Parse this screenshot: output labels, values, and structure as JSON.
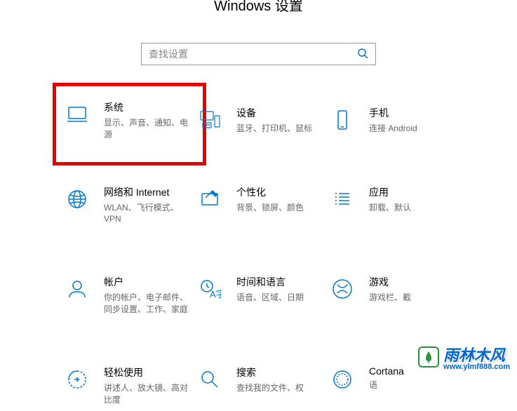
{
  "header": {
    "title": "Windows 设置"
  },
  "search": {
    "placeholder": "查找设置"
  },
  "tiles": {
    "system": {
      "title": "系统",
      "desc": "显示、声音、通知、电源"
    },
    "devices": {
      "title": "设备",
      "desc": "蓝牙、打印机、鼠标"
    },
    "phone": {
      "title": "手机",
      "desc": "连接 Android"
    },
    "network": {
      "title": "网络和 Internet",
      "desc": "WLAN、飞行模式、VPN"
    },
    "personalization": {
      "title": "个性化",
      "desc": "背景、锁屏、颜色"
    },
    "apps": {
      "title": "应用",
      "desc": "卸载、默认"
    },
    "accounts": {
      "title": "帐户",
      "desc": "你的帐户、电子邮件、同步设置、工作、家庭"
    },
    "time": {
      "title": "时间和语言",
      "desc": "语音、区域、日期"
    },
    "gaming": {
      "title": "游戏",
      "desc": "游戏栏、截"
    },
    "ease": {
      "title": "轻松使用",
      "desc": "讲述人、放大镜、高对比度"
    },
    "searchtile": {
      "title": "搜索",
      "desc": "查找我的文件、权"
    },
    "cortana": {
      "title": "Cortana",
      "desc": "语"
    }
  },
  "watermark": {
    "brand": "雨林木风",
    "url": "www.ylmf888.com"
  }
}
